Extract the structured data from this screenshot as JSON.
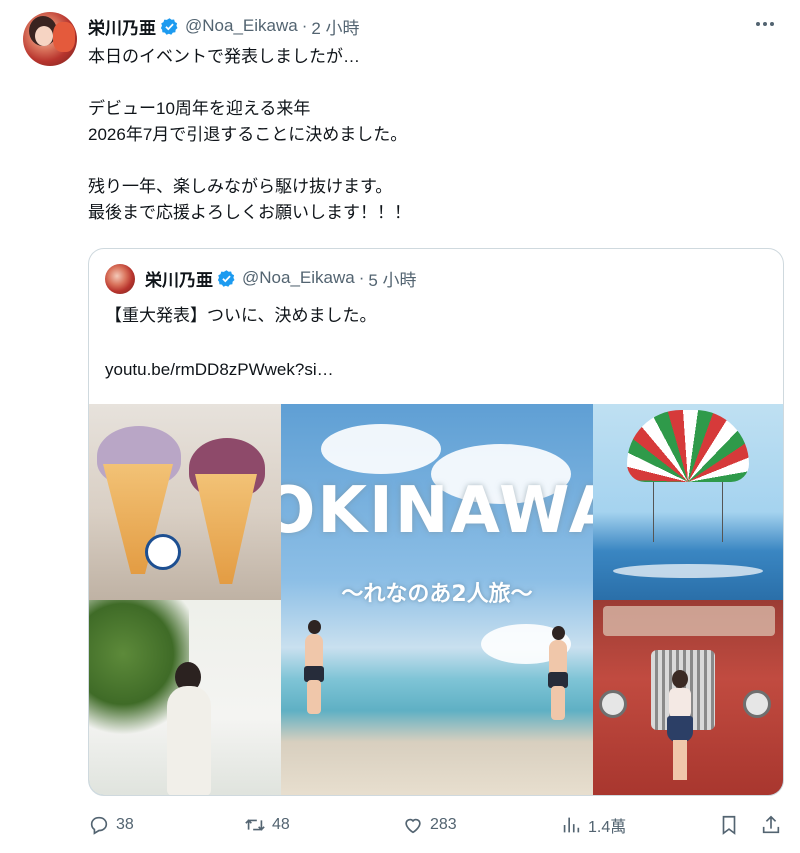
{
  "tweet": {
    "display_name": "栄川乃亜",
    "handle": "@Noa_Eikawa",
    "dot": "·",
    "time": "2 小時",
    "text": "本日のイベントで発表しましたが…\n\nデビュー10周年を迎える来年\n2026年7月で引退することに決めました。\n\n残り一年、楽しみながら駆け抜けます。\n最後まで応援よろしくお願いします！！！"
  },
  "quoted": {
    "display_name": "栄川乃亜",
    "handle": "@Noa_Eikawa",
    "dot": "·",
    "time": "5 小時",
    "text": "【重大発表】ついに、決めました。",
    "link": "youtu.be/rmDD8zPWwek?si…",
    "thumbnail": {
      "title": "OKINAWA",
      "subtitle": "〜れなのあ2人旅〜"
    }
  },
  "actions": {
    "replies": "38",
    "retweets": "48",
    "likes": "283",
    "views": "1.4萬"
  },
  "icons": [
    "verified-icon",
    "more-icon",
    "reply-icon",
    "retweet-icon",
    "like-icon",
    "views-icon",
    "bookmark-icon",
    "share-icon"
  ],
  "colors": {
    "verified": "#1d9bf0",
    "secondary_text": "#536471",
    "border": "#cfd9de"
  }
}
